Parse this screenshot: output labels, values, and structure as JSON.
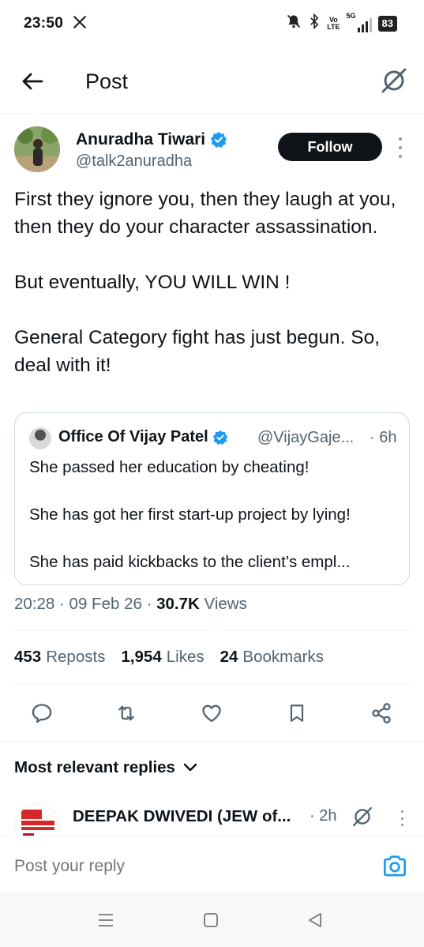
{
  "status_bar": {
    "time": "23:50",
    "volte_top": "Vo",
    "volte_bottom": "LTE",
    "network": "5G",
    "battery": "83"
  },
  "header": {
    "title": "Post"
  },
  "post": {
    "author_name": "Anuradha Tiwari",
    "author_handle": "@talk2anuradha",
    "follow_label": "Follow",
    "text": "First they ignore you, then they laugh at you, then they do your character assassination.\n\nBut eventually, YOU WILL WIN !\n\nGeneral Category fight has just begun. So, deal with it!",
    "time": "20:28",
    "date": "09 Feb 26",
    "views_count": "30.7K",
    "views_label": "Views",
    "reposts_count": "453",
    "reposts_label": "Reposts",
    "likes_count": "1,954",
    "likes_label": "Likes",
    "bookmarks_count": "24",
    "bookmarks_label": "Bookmarks"
  },
  "quote": {
    "author_name": "Office Of Vijay Patel",
    "author_handle": "@VijayGaje...",
    "time": "· 6h",
    "text": "She passed her education by cheating!\n\nShe has got her first start-up project by lying!\n\nShe has paid kickbacks to the client’s empl..."
  },
  "replies": {
    "header": "Most relevant replies",
    "items": [
      {
        "author_name": "DEEPAK DWIVEDI (JEW of...",
        "time": "· 2h"
      }
    ]
  },
  "reply_bar": {
    "placeholder": "Post your reply"
  },
  "colors": {
    "verified": "#1d9bf0",
    "camera": "#1d9bf0",
    "follow_bg": "#0f1419",
    "muted_text": "#536471"
  }
}
